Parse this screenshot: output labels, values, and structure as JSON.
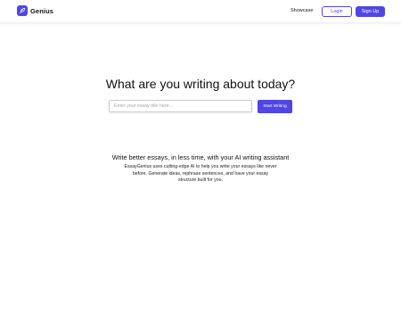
{
  "header": {
    "brand_name": "Genius",
    "logo_icon": "feather-icon",
    "nav": {
      "showcase_label": "Showcase"
    },
    "login_label": "Login",
    "signup_label": "Sign Up"
  },
  "hero": {
    "headline": "What are you writing about today?",
    "input": {
      "placeholder": "Enter your essay title here...",
      "value": ""
    },
    "start_button_label": "Start Writing"
  },
  "info": {
    "tagline": "Write better essays, in less time, with your AI writing assistant",
    "description": "EssayGenius uses cutting-edge AI to help you write your essays like never before. Generate ideas, rephrase sentences, and have your essay structure built for you."
  },
  "colors": {
    "accent": "#4f46e5",
    "background": "#ffffff",
    "text": "#111111"
  }
}
